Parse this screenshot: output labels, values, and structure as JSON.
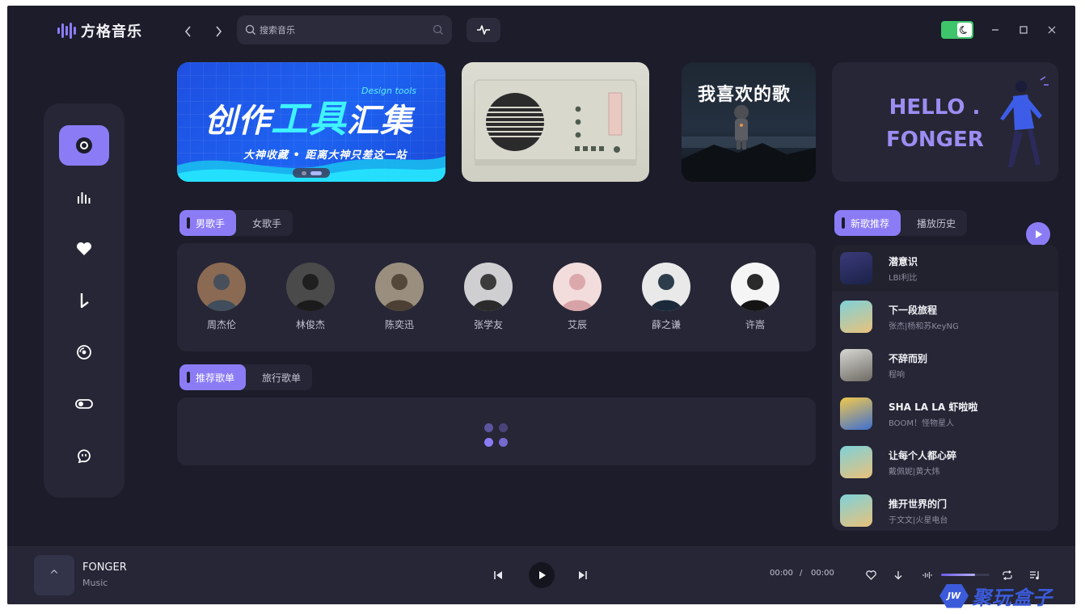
{
  "app": {
    "name": "方格音乐"
  },
  "search": {
    "placeholder": "搜索音乐"
  },
  "banners": {
    "design": {
      "tag": "Design tools",
      "title_a": "创作",
      "title_b": "工具",
      "title_c": "汇集",
      "subtitle": "大神收藏 • 距离大神只差这一站"
    },
    "favorite": {
      "title": "我喜欢的歌"
    },
    "hello": {
      "line1": "HELLO .",
      "line2": "FONGER"
    }
  },
  "singer_tabs": [
    {
      "label": "男歌手",
      "active": true
    },
    {
      "label": "女歌手",
      "active": false
    }
  ],
  "artists": [
    {
      "name": "周杰伦",
      "color_a": "#8a6a52",
      "color_b": "#3f4d5c"
    },
    {
      "name": "林俊杰",
      "color_a": "#4a4a4a",
      "color_b": "#1b1b1b"
    },
    {
      "name": "陈奕迅",
      "color_a": "#9a8f7e",
      "color_b": "#4c4034"
    },
    {
      "name": "张学友",
      "color_a": "#cfcfd2",
      "color_b": "#2b2b2b"
    },
    {
      "name": "艾辰",
      "color_a": "#f3dcdc",
      "color_b": "#d8a3a6"
    },
    {
      "name": "薛之谦",
      "color_a": "#e9e9ea",
      "color_b": "#1a2a3a"
    },
    {
      "name": "许嵩",
      "color_a": "#f5f5f5",
      "color_b": "#141414"
    }
  ],
  "playlist_tabs": [
    {
      "label": "推荐歌单",
      "active": true
    },
    {
      "label": "旅行歌单",
      "active": false
    }
  ],
  "song_tabs": [
    {
      "label": "新歌推荐",
      "active": true
    },
    {
      "label": "播放历史",
      "active": false
    }
  ],
  "songs": [
    {
      "title": "潜意识",
      "artist": "LBI利比",
      "active": true,
      "cover_a": "#3b3a7a",
      "cover_b": "#1a2248"
    },
    {
      "title": "下一段旅程",
      "artist": "张杰|杨和苏KeyNG",
      "active": false,
      "cover_a": "#7fd1d9",
      "cover_b": "#e9c27a"
    },
    {
      "title": "不辞而别",
      "artist": "程响",
      "active": false,
      "cover_a": "#d8d8d4",
      "cover_b": "#6e6a63"
    },
    {
      "title": "SHA LA LA 虾啦啦",
      "artist": "BOOM！怪物星人",
      "active": false,
      "cover_a": "#f2c94c",
      "cover_b": "#3f6fd1"
    },
    {
      "title": "让每个人都心碎",
      "artist": "戴佩妮|黄大炜",
      "active": false,
      "cover_a": "#7fd1d9",
      "cover_b": "#e9c27a"
    },
    {
      "title": "推开世界的门",
      "artist": "于文文|火星电台",
      "active": false,
      "cover_a": "#7fd1d9",
      "cover_b": "#e9c27a"
    }
  ],
  "player": {
    "cover_glyph": "^",
    "title": "FONGER",
    "subtitle": "Music",
    "current_time": "00:00",
    "separator": "/",
    "total_time": "00:00",
    "volume": 0.7
  },
  "watermark": {
    "badge": "JW",
    "text": "聚玩盒子"
  },
  "colors": {
    "accent": "#8b7cf6",
    "bg": "#1c1c2a",
    "panel": "#262636",
    "toggle": "#3ec46a"
  }
}
